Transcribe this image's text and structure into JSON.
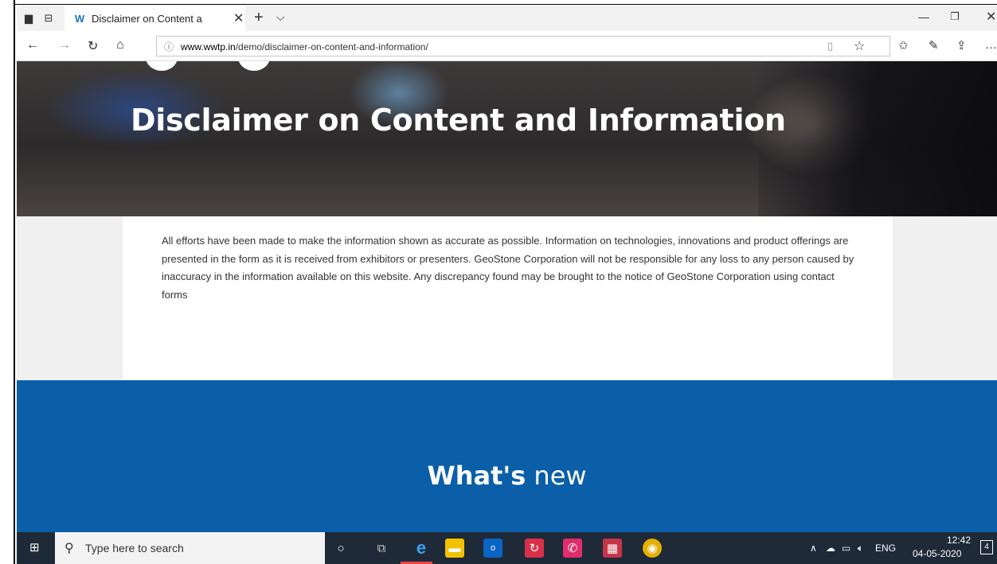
{
  "browser": {
    "tab_title": "Disclaimer on Content a",
    "favicon": "W",
    "url_host": "www.wwtp.in",
    "url_path": "/demo/disclaimer-on-content-and-information/"
  },
  "page": {
    "hero_title": "Disclaimer on Content and Information",
    "body_text": "All efforts have been made to make the information shown as accurate as possible. Information on technologies, innovations and product offerings are presented in the form as it is received from exhibitors or presenters. GeoStone Corporation will not be responsible for any loss to any person caused by inaccuracy in the information available on this website. Any discrepancy found may be brought to the notice of GeoStone Corporation using contact forms",
    "section_title_bold": "What's",
    "section_title_rest": "new"
  },
  "taskbar": {
    "search_placeholder": "Type here to search",
    "language": "ENG",
    "time": "12:42",
    "date": "04-05-2020",
    "notifications": "4"
  },
  "colors": {
    "section_blue": "#0a5fa8",
    "taskbar": "#1e2a38"
  }
}
